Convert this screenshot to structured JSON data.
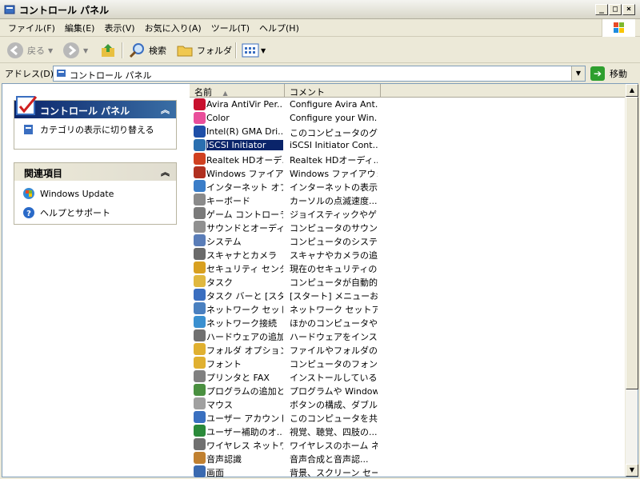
{
  "window": {
    "title": "コントロール パネル"
  },
  "menu": [
    "ファイル(F)",
    "編集(E)",
    "表示(V)",
    "お気に入り(A)",
    "ツール(T)",
    "ヘルプ(H)"
  ],
  "toolbar": {
    "back": "戻る",
    "search": "検索",
    "folders": "フォルダ"
  },
  "address": {
    "label": "アドレス(D)",
    "value": "コントロール パネル",
    "go": "移動"
  },
  "left": {
    "panel1": {
      "title": "コントロール パネル",
      "link": "カテゴリの表示に切り替える"
    },
    "panel2": {
      "title": "関連項目",
      "links": [
        "Windows Update",
        "ヘルプとサポート"
      ]
    }
  },
  "list": {
    "columns": [
      "名前",
      "コメント"
    ],
    "rows": [
      {
        "name": "Avira AntiVir Per...",
        "comment": "Configure Avira Ant...",
        "color": "#c8102e"
      },
      {
        "name": "Color",
        "comment": "Configure your Win...",
        "color": "#e94f9b"
      },
      {
        "name": "Intel(R) GMA Dri...",
        "comment": "このコンピュータのグラ...",
        "color": "#1e4fa8"
      },
      {
        "name": "iSCSI Initiator",
        "comment": "iSCSI Initiator Cont...",
        "color": "#2a6fb0",
        "selected": true
      },
      {
        "name": "Realtek HDオーデ...",
        "comment": "Realtek HDオーディ...",
        "color": "#d04020"
      },
      {
        "name": "Windows ファイアウ...",
        "comment": "Windows ファイアウォ...",
        "color": "#b03020"
      },
      {
        "name": "インターネット オプ...",
        "comment": "インターネットの表示...",
        "color": "#3a7dc8"
      },
      {
        "name": "キーボード",
        "comment": "カーソルの点滅速度...",
        "color": "#8a8a8a"
      },
      {
        "name": "ゲーム コントローラ",
        "comment": "ジョイスティックやゲー...",
        "color": "#7a7a7a"
      },
      {
        "name": "サウンドとオーディオ...",
        "comment": "コンピュータのサウンド...",
        "color": "#909090"
      },
      {
        "name": "システム",
        "comment": "コンピュータのシステム...",
        "color": "#5a7db8"
      },
      {
        "name": "スキャナとカメラ",
        "comment": "スキャナやカメラの追...",
        "color": "#6a6a6a"
      },
      {
        "name": "セキュリティ センター",
        "comment": "現在のセキュリティの...",
        "color": "#d8a020"
      },
      {
        "name": "タスク",
        "comment": "コンピュータが自動的...",
        "color": "#e0b840"
      },
      {
        "name": "タスク バーと [スタ...",
        "comment": "[スタート] メニューおよ...",
        "color": "#3a6ec0"
      },
      {
        "name": "ネットワーク セットア...",
        "comment": "ネットワーク セットアッ...",
        "color": "#4a80c0"
      },
      {
        "name": "ネットワーク接続",
        "comment": "ほかのコンピュータやネ...",
        "color": "#3a90d0"
      },
      {
        "name": "ハードウェアの追加",
        "comment": "ハードウェアをインスト...",
        "color": "#707070"
      },
      {
        "name": "フォルダ オプション",
        "comment": "ファイルやフォルダの表...",
        "color": "#e0b030"
      },
      {
        "name": "フォント",
        "comment": "コンピュータのフォント...",
        "color": "#e0b030"
      },
      {
        "name": "プリンタと FAX",
        "comment": "インストールしているプ...",
        "color": "#808080"
      },
      {
        "name": "プログラムの追加と...",
        "comment": "プログラムや Window...",
        "color": "#4a9040"
      },
      {
        "name": "マウス",
        "comment": "ボタンの構成、ダブル...",
        "color": "#a0a0a0"
      },
      {
        "name": "ユーザー アカウント",
        "comment": "このコンピュータを共...",
        "color": "#3a70c0"
      },
      {
        "name": "ユーザー補助のオ...",
        "comment": "視覚、聴覚、四肢の...",
        "color": "#2a8a3a"
      },
      {
        "name": "ワイヤレス ネットワ...",
        "comment": "ワイヤレスのホーム ネ...",
        "color": "#707070"
      },
      {
        "name": "音声認識",
        "comment": "音声合成と音声認...",
        "color": "#c08030"
      },
      {
        "name": "画面",
        "comment": "背景、スクリーン セー...",
        "color": "#3a6ab0"
      }
    ]
  }
}
